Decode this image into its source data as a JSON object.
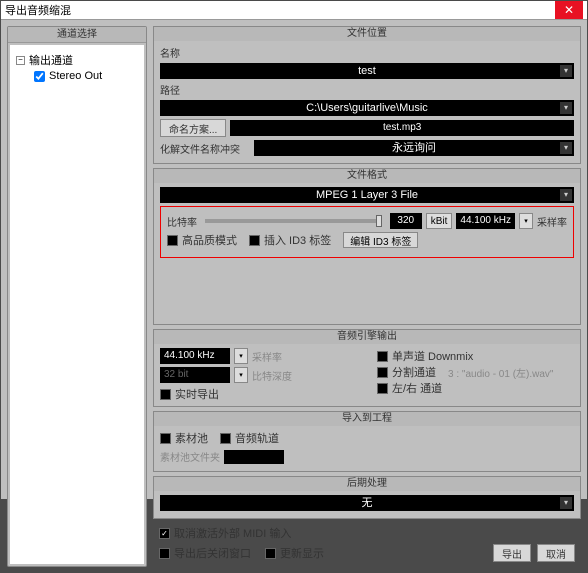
{
  "window": {
    "title": "导出音频缩混"
  },
  "left": {
    "header": "通道选择",
    "root": "输出通道",
    "child": "Stereo Out"
  },
  "loc": {
    "header": "文件位置",
    "name_lbl": "名称",
    "name_val": "test",
    "path_lbl": "路径",
    "path_val": "C:\\Users\\guitarlive\\Music",
    "naming_btn": "命名方案...",
    "file_val": "test.mp3",
    "conflict_lbl": "化解文件名称冲突",
    "conflict_val": "永远询问"
  },
  "fmt": {
    "header": "文件格式",
    "codec": "MPEG 1 Layer 3 File",
    "bitrate_lbl": "比特率",
    "bitrate_val": "320",
    "bitrate_unit": "kBit",
    "samplerate": "44.100 kHz",
    "samplerate_lbl": "采样率",
    "hq": "高品质模式",
    "id3_insert": "插入 ID3 标签",
    "id3_edit": "编辑 ID3 标签"
  },
  "engine": {
    "header": "音频引擎输出",
    "sr_val": "44.100 kHz",
    "sr_lbl": "采样率",
    "bd_val": "32 bit",
    "bd_lbl": "比特深度",
    "realtime": "实时导出",
    "mono": "单声道 Downmix",
    "split": "分割通道",
    "split_val": "3 : \"audio - 01 (左).wav\"",
    "lr": "左/右 通道"
  },
  "proj": {
    "header": "导入到工程",
    "pool": "素材池",
    "track": "音频轨道",
    "pool_folder": "素材池文件夹"
  },
  "post": {
    "header": "后期处理",
    "val": "无"
  },
  "opts": {
    "midi": "取消激活外部 MIDI 输入",
    "close": "导出后关闭窗口",
    "update": "更新显示"
  },
  "btns": {
    "export": "导出",
    "cancel": "取消"
  }
}
